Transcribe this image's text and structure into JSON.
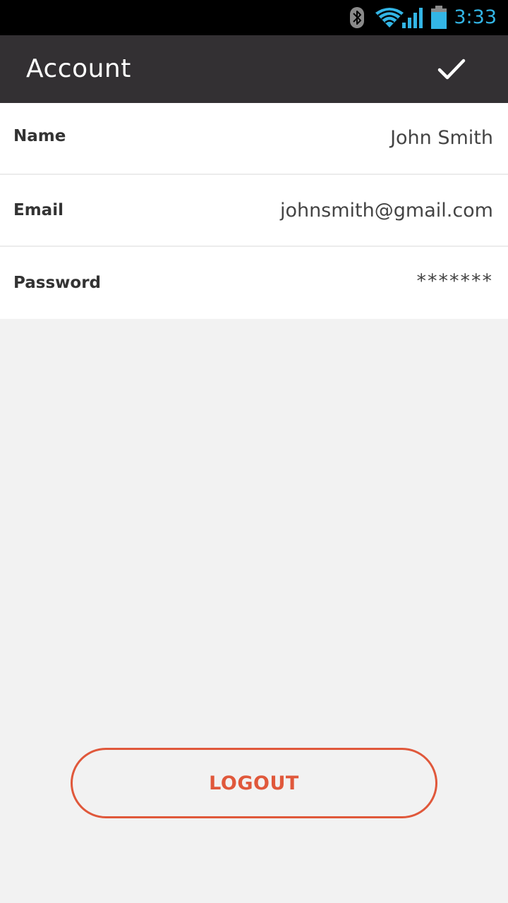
{
  "status_bar": {
    "time": "3:33",
    "icons": [
      "bluetooth-icon",
      "wifi-icon",
      "signal-icon",
      "battery-icon"
    ],
    "accent_color": "#33b5e5"
  },
  "app_bar": {
    "title": "Account",
    "confirm_icon": "checkmark-icon",
    "background_color": "#333033"
  },
  "fields": [
    {
      "label": "Name",
      "value": "John Smith"
    },
    {
      "label": "Email",
      "value": "johnsmith@gmail.com"
    },
    {
      "label": "Password",
      "value": "*******"
    }
  ],
  "logout": {
    "label": "LOGOUT",
    "color": "#e0583b"
  }
}
